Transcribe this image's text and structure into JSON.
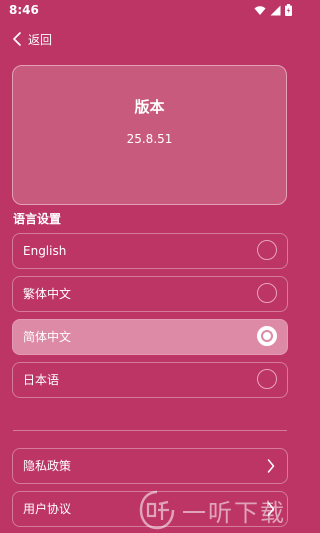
{
  "status_bar": {
    "time": "8:46"
  },
  "nav": {
    "back_label": "返回"
  },
  "version_card": {
    "title": "版本",
    "version": "25.8.51"
  },
  "language": {
    "heading": "语言设置",
    "options": [
      {
        "label": "English",
        "selected": false
      },
      {
        "label": "繁体中文",
        "selected": false
      },
      {
        "label": "简体中文",
        "selected": true
      },
      {
        "label": "日本语",
        "selected": false
      }
    ]
  },
  "links": [
    {
      "label": "隐私政策"
    },
    {
      "label": "用户协议"
    }
  ],
  "watermark": {
    "text": "一听下载"
  },
  "colors": {
    "background": "#bc3564",
    "card": "#c85a7d",
    "selected": "#dc8aa6"
  }
}
